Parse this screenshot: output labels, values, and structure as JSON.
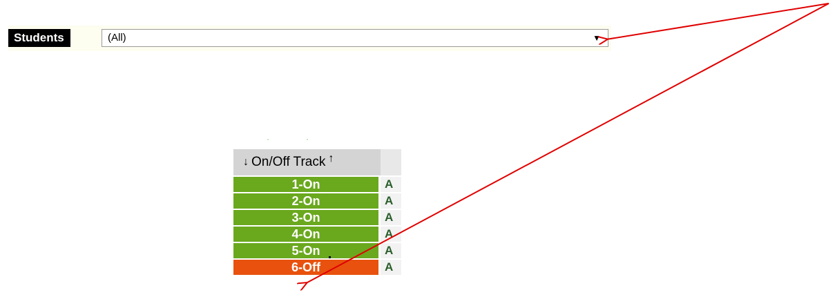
{
  "filter": {
    "label": "Students",
    "value": "(All)",
    "caret_icon": "caret-down-icon"
  },
  "track_table": {
    "header": "On/Off Track",
    "sort_down_icon": "arrow-down-icon",
    "sort_up_icon": "arrow-up-icon",
    "rows": [
      {
        "label": "1-On",
        "status": "on",
        "extra": "A"
      },
      {
        "label": "2-On",
        "status": "on",
        "extra": "A"
      },
      {
        "label": "3-On",
        "status": "on",
        "extra": "A"
      },
      {
        "label": "4-On",
        "status": "on",
        "extra": "A"
      },
      {
        "label": "5-On",
        "status": "on",
        "extra": "A"
      },
      {
        "label": "6-Off",
        "status": "off",
        "extra": "A"
      }
    ]
  },
  "colors": {
    "on": "#6aa81e",
    "off": "#e8520e",
    "annotation_arrow": "#e00000"
  }
}
